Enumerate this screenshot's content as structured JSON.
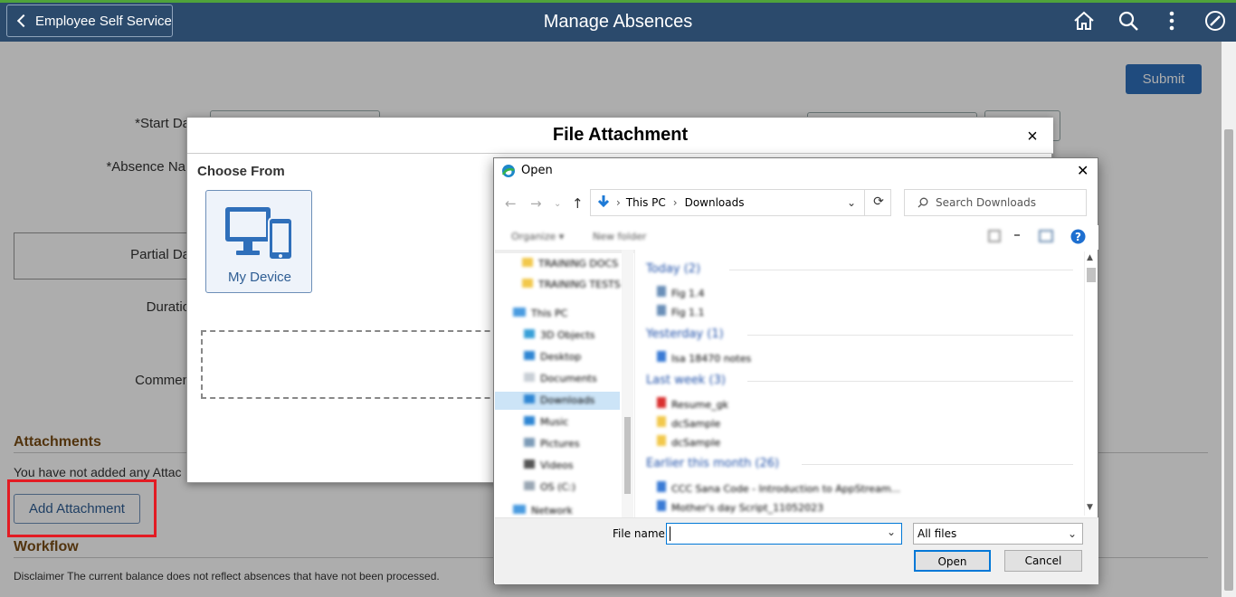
{
  "header": {
    "back_label": "Employee Self Service",
    "title": "Manage Absences",
    "icons": [
      "home-icon",
      "search-icon",
      "more-vertical-icon",
      "navbar-compass-icon"
    ]
  },
  "form": {
    "submit_label": "Submit",
    "start_date_label": "*Start Da",
    "absence_name_label": "*Absence Nar",
    "partial_days_label": "Partial Da",
    "duration_label": "Duratio",
    "comments_label": "Commen",
    "attachments_heading": "Attachments",
    "no_attachments_text": "You have not added any Attac",
    "add_attachment_label": "Add Attachment",
    "workflow_heading": "Workflow",
    "disclaimer": "Disclaimer  The current balance does not reflect absences that have not been processed."
  },
  "file_attachment_modal": {
    "title": "File Attachment",
    "close_symbol": "×",
    "choose_from_label": "Choose From",
    "device_label": "My Device"
  },
  "open_dialog": {
    "title": "Open",
    "close_symbol": "✕",
    "breadcrumb": [
      "This PC",
      "Downloads"
    ],
    "search_placeholder": "Search Downloads",
    "organize_label": "Organize ▾",
    "new_folder_label": "New folder",
    "nav_items": [
      "TRAINING DOCS",
      "TRAINING TESTS",
      "This PC",
      "3D Objects",
      "Desktop",
      "Documents",
      "Downloads",
      "Music",
      "Pictures",
      "Videos",
      "OS (C:)",
      "Network"
    ],
    "groups": [
      {
        "heading": "Today (2)",
        "files": [
          "Fig 1.4",
          "Fig 1.1"
        ]
      },
      {
        "heading": "Yesterday (1)",
        "files": [
          "Isa 18470 notes"
        ]
      },
      {
        "heading": "Last week (3)",
        "files": [
          "Resume_gk",
          "dcSample",
          "dcSample"
        ]
      },
      {
        "heading": "Earlier this month (26)",
        "files": [
          "CCC Sana Code - Introduction to AppStream...",
          "Mother's day Script_11052023"
        ]
      }
    ],
    "file_name_label": "File name:",
    "file_name_value": "",
    "filter_value": "All files",
    "open_label": "Open",
    "cancel_label": "Cancel"
  },
  "colors": {
    "header_bg": "#2b4a6c",
    "accent": "#2f6fba",
    "section_heading": "#7a4d16",
    "highlight_box": "#e31b23"
  }
}
